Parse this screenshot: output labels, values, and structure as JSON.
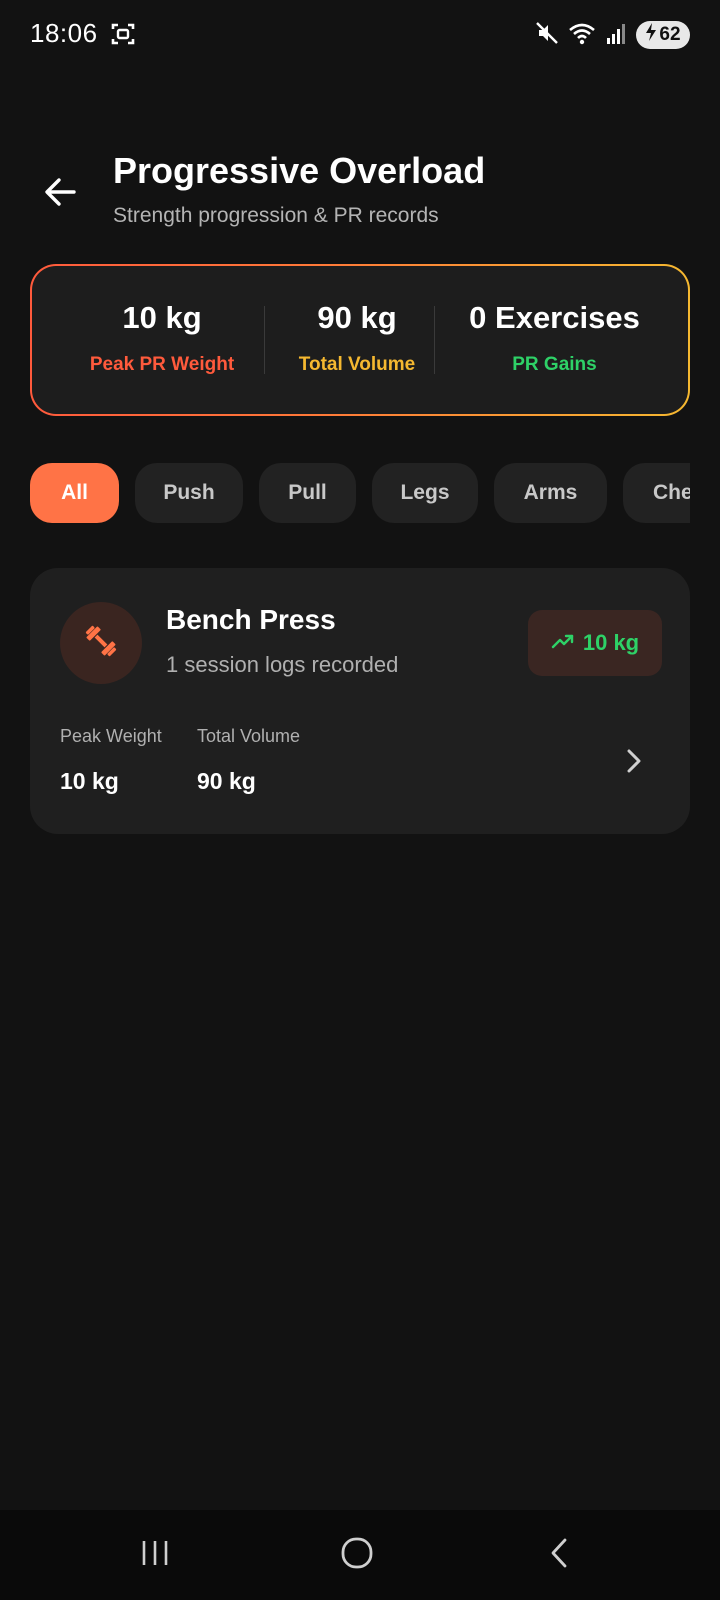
{
  "status_bar": {
    "time": "18:06",
    "battery": "62",
    "icons": [
      "screenshot-icon",
      "mute-icon",
      "wifi-icon",
      "signal-icon",
      "charging-icon"
    ]
  },
  "header": {
    "title": "Progressive Overload",
    "subtitle": "Strength progression & PR records"
  },
  "summary": {
    "stats": [
      {
        "value": "10 kg",
        "label": "Peak PR Weight",
        "color": "#ff5a3c"
      },
      {
        "value": "90 kg",
        "label": "Total Volume",
        "color": "#f5b830"
      },
      {
        "value": "0 Exercises",
        "label": "PR Gains",
        "color": "#2ed167"
      }
    ]
  },
  "filters": {
    "selected": "All",
    "chips": [
      "All",
      "Push",
      "Pull",
      "Legs",
      "Arms",
      "Che"
    ]
  },
  "exercises": [
    {
      "name": "Bench Press",
      "subtitle": "1 session logs recorded",
      "pr_badge": "10 kg",
      "metrics": [
        {
          "label": "Peak Weight",
          "value": "10 kg"
        },
        {
          "label": "Total Volume",
          "value": "90 kg"
        }
      ]
    }
  ],
  "colors": {
    "accent": "#ff7346",
    "background": "#121212",
    "card": "#1f1f1f",
    "success": "#2ed167"
  }
}
